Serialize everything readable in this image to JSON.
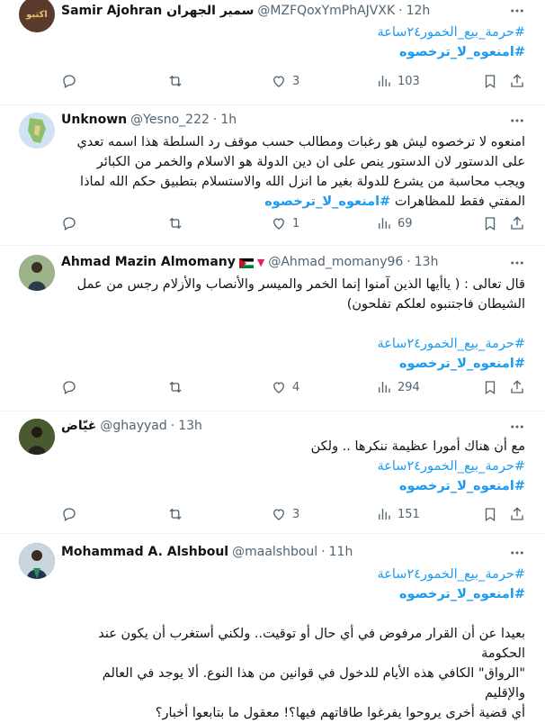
{
  "tweets": [
    {
      "name": "Samir Ajohran سمير الجهران",
      "handle": "@MZFQoxYmPhAJVXK",
      "time": "12h",
      "lines": [],
      "hashtags": [
        "#حرمة_بيع_الخمور٢٤ساعة",
        "#امنعوه_لا_ترخصوه"
      ],
      "replies": "",
      "retweets": "",
      "likes": "3",
      "views": "103",
      "avatar_color": "#5a3a2a",
      "avatar_text": "اكتبو"
    },
    {
      "name": "Unknown",
      "handle": "@Yesno_222",
      "time": "1h",
      "lines": [
        "امنعوه لا ترخصوه ليش هو رغبات ومطالب حسب موقف رد السلطة هذا اسمه تعدي",
        "على الدستور لان الدستور ينص على ان دين الدولة هو الاسلام والخمر من الكبائر",
        "ويجب محاسبة من يشرع للدولة بغير ما انزل الله والاستسلام بتطبيق حكم الله لماذا",
        "المفتي فقط للمظاهرات "
      ],
      "inline_tag": "#امنعوه_لا_ترخصوه",
      "hashtags": [],
      "replies": "",
      "retweets": "",
      "likes": "1",
      "views": "69",
      "avatar_color": "#7fb2d9"
    },
    {
      "name": "Ahmad Mazin Almomany",
      "name_suffix": "▼",
      "handle": "@Ahmad_momany96",
      "time": "13h",
      "lines": [
        "قال تعالى : ( ياأيها الذين آمنوا إنما الخمر والميسر والأنصاب والأزلام رجس من عمل",
        "الشيطان فاجتنبوه لعلكم تفلحون)"
      ],
      "hashtags": [
        "#حرمة_بيع_الخمور٢٤ساعة",
        "#امنعوه_لا_ترخصوه"
      ],
      "replies": "",
      "retweets": "",
      "likes": "4",
      "views": "294",
      "avatar_color": "#6a8a5a"
    },
    {
      "name": "غيّاض",
      "handle": "@ghayyad",
      "time": "13h",
      "lines": [
        "مع أن هناك أمورا عظيمة ننكرها .. ولكن"
      ],
      "hashtags": [
        "#حرمة_بيع_الخمور٢٤ساعة",
        "#امنعوه_لا_ترخصوه"
      ],
      "replies": "",
      "retweets": "",
      "likes": "3",
      "views": "151",
      "avatar_color": "#3d4a2a"
    },
    {
      "name": "Mohammad A. Alshboul",
      "handle": "@maalshboul",
      "time": "11h",
      "lines": [],
      "hashtags": [
        "#حرمة_بيع_الخمور٢٤ساعة",
        "#امنعوه_لا_ترخصوه"
      ],
      "lines_after": [
        "بعيدا عن أن القرار مرفوض في أي حال أو توقيت.. ولكني أستغرب أن يكون عند الحكومة",
        "\"الرواق\" الكافي هذه الأيام للدخول في قوانين من هذا النوع. ألا يوجد في العالم والإقليم",
        "أي قضية أخرى يروحوا يفرغوا طاقاتهم فيها؟! معقول ما بتابعوا أخبار؟"
      ],
      "avatar_color": "#2a4a6a"
    }
  ],
  "dot": "·",
  "colors": {
    "accent": "#1d9bf0",
    "muted": "#536471",
    "divider": "#eff3f4"
  },
  "icons": [
    "reply-icon",
    "retweet-icon",
    "like-icon",
    "views-icon",
    "bookmark-icon",
    "share-icon",
    "more-icon"
  ]
}
